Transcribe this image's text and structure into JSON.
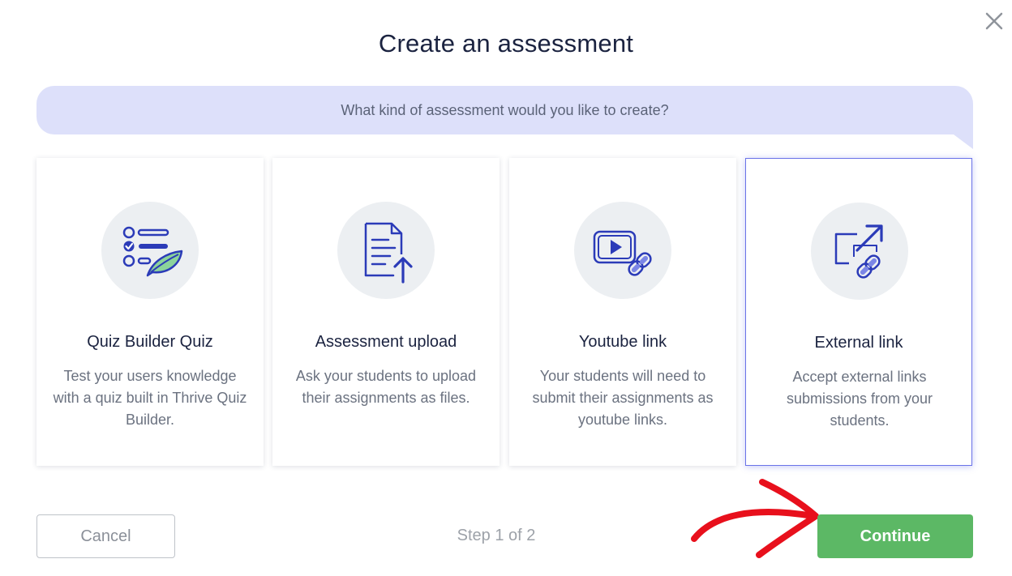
{
  "dialog": {
    "title": "Create an assessment",
    "prompt": "What kind of assessment would you like to create?"
  },
  "options": [
    {
      "title": "Quiz Builder Quiz",
      "description": "Test your users knowledge with a quiz built in Thrive Quiz Builder.",
      "icon": "quiz-list-leaf-icon",
      "selected": false
    },
    {
      "title": "Assessment upload",
      "description": "Ask your students to upload their assignments as files.",
      "icon": "file-upload-icon",
      "selected": false
    },
    {
      "title": "Youtube link",
      "description": "Your students will need to submit their assignments as youtube links.",
      "icon": "video-link-icon",
      "selected": false
    },
    {
      "title": "External link",
      "description": "Accept external links submissions from your students.",
      "icon": "external-link-icon",
      "selected": true
    }
  ],
  "footer": {
    "cancel_label": "Cancel",
    "step_text": "Step 1 of 2",
    "continue_label": "Continue"
  },
  "colors": {
    "accent": "#2b3bb8",
    "bubble": "#dde0fa",
    "continue": "#5cb865",
    "selected_border": "#6a73e8",
    "annotation_arrow": "#e8101c"
  }
}
